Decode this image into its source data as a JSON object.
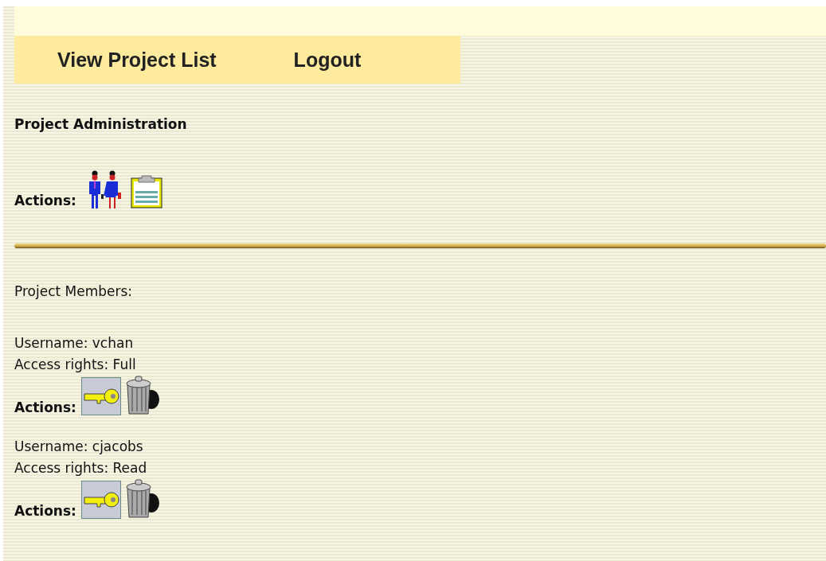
{
  "nav_links": [
    {
      "label": "View Project List"
    },
    {
      "label": "Logout"
    }
  ],
  "heading": "Project Administration",
  "actions_label": "Actions:",
  "members_heading": "Project Members:",
  "members": [
    {
      "username": "Username: vchan",
      "access": "Access rights: Full",
      "actions_label": "Actions:"
    },
    {
      "username": "Username: cjacobs",
      "access": "Access rights: Read",
      "actions_label": "Actions:"
    }
  ]
}
